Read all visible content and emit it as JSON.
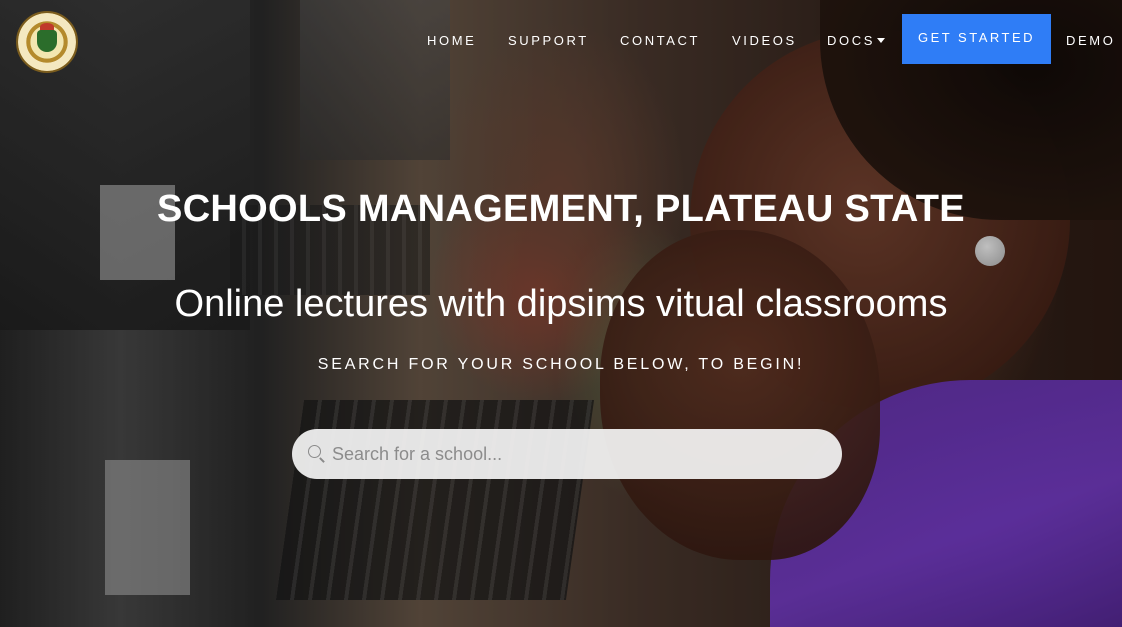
{
  "nav": {
    "items": [
      {
        "label": "HOME"
      },
      {
        "label": "SUPPORT"
      },
      {
        "label": "CONTACT"
      },
      {
        "label": "VIDEOS"
      },
      {
        "label": "DOCS"
      },
      {
        "label": "DEMO"
      }
    ],
    "cta_label": "GET STARTED",
    "cta_color": "#2f7df6"
  },
  "logo": {
    "alt": "Government of Plateau State of Nigeria seal",
    "icon": "state-seal-icon"
  },
  "hero": {
    "title": "SCHOOLS MANAGEMENT, PLATEAU STATE",
    "subtitle": "Online lectures with dipsims vitual classrooms",
    "tagline": "SEARCH FOR YOUR SCHOOL BELOW, TO BEGIN!"
  },
  "search": {
    "placeholder": "Search for a school...",
    "value": "",
    "icon": "search-icon"
  }
}
